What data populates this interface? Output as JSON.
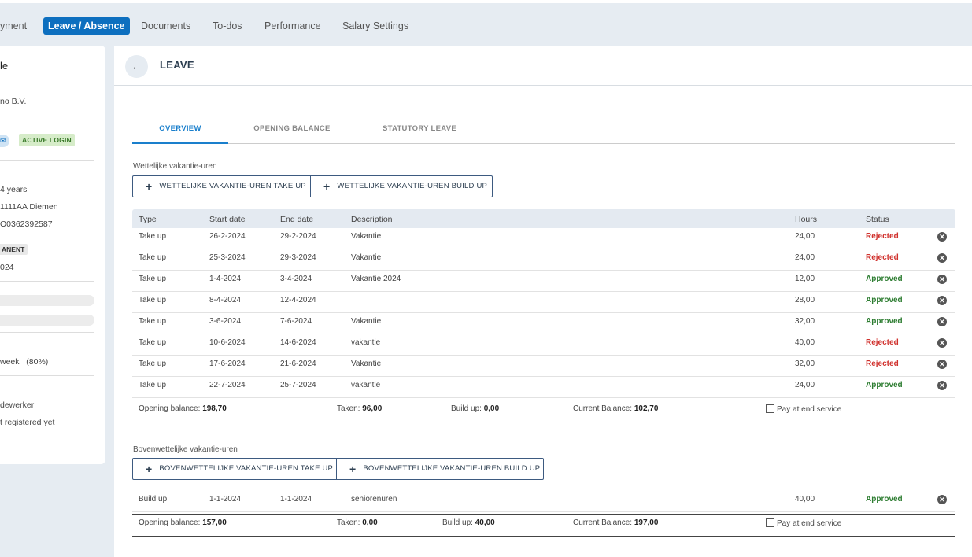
{
  "topnav": {
    "items": [
      {
        "label": "yment"
      },
      {
        "label": "Leave / Absence",
        "active": true
      },
      {
        "label": "Documents"
      },
      {
        "label": "To-dos"
      },
      {
        "label": "Performance"
      },
      {
        "label": "Salary Settings"
      }
    ]
  },
  "sidebar": {
    "title": "le",
    "company": "no B.V.",
    "login_badge": "ACTIVE LOGIN",
    "age": "4 years",
    "address": "1111AA Diemen",
    "iban": "O0362392587",
    "contract_badge": "ANENT",
    "contract_date": "024",
    "hours": "week",
    "hours_pct": "(80%)",
    "role": "dewerker",
    "not_registered": "t registered yet"
  },
  "header": {
    "title": "LEAVE",
    "back_icon": "arrow-left-icon"
  },
  "tabs": [
    {
      "label": "OVERVIEW",
      "active": true
    },
    {
      "label": "OPENING BALANCE"
    },
    {
      "label": "STATUTORY LEAVE"
    }
  ],
  "columns": [
    "Type",
    "Start date",
    "End date",
    "Description",
    "Hours",
    "Status"
  ],
  "statutory": {
    "label": "Wettelijke vakantie-uren",
    "take_up_button": "WETTELIJKE VAKANTIE-UREN TAKE UP",
    "build_up_button": "WETTELIJKE VAKANTIE-UREN BUILD UP",
    "rows": [
      {
        "type": "Take up",
        "start": "26-2-2024",
        "end": "29-2-2024",
        "description": "Vakantie",
        "hours": "24,00",
        "status": "Rejected"
      },
      {
        "type": "Take up",
        "start": "25-3-2024",
        "end": "29-3-2024",
        "description": "Vakantie",
        "hours": "24,00",
        "status": "Rejected"
      },
      {
        "type": "Take up",
        "start": "1-4-2024",
        "end": "3-4-2024",
        "description": "Vakantie 2024",
        "hours": "12,00",
        "status": "Approved"
      },
      {
        "type": "Take up",
        "start": "8-4-2024",
        "end": "12-4-2024",
        "description": "",
        "hours": "28,00",
        "status": "Approved"
      },
      {
        "type": "Take up",
        "start": "3-6-2024",
        "end": "7-6-2024",
        "description": "Vakantie",
        "hours": "32,00",
        "status": "Approved"
      },
      {
        "type": "Take up",
        "start": "10-6-2024",
        "end": "14-6-2024",
        "description": "vakantie",
        "hours": "40,00",
        "status": "Rejected"
      },
      {
        "type": "Take up",
        "start": "17-6-2024",
        "end": "21-6-2024",
        "description": "Vakantie",
        "hours": "32,00",
        "status": "Rejected"
      },
      {
        "type": "Take up",
        "start": "22-7-2024",
        "end": "25-7-2024",
        "description": "vakantie",
        "hours": "24,00",
        "status": "Approved"
      }
    ],
    "summary": {
      "opening_label": "Opening balance:",
      "opening": "198,70",
      "taken_label": "Taken:",
      "taken": "96,00",
      "buildup_label": "Build up:",
      "buildup": "0,00",
      "current_label": "Current Balance:",
      "current": "102,70",
      "pay_label": "Pay at end service"
    }
  },
  "extra": {
    "label": "Bovenwettelijke vakantie-uren",
    "take_up_button": "BOVENWETTELIJKE VAKANTIE-UREN TAKE UP",
    "build_up_button": "BOVENWETTELIJKE VAKANTIE-UREN BUILD UP",
    "rows": [
      {
        "type": "Build up",
        "start": "1-1-2024",
        "end": "1-1-2024",
        "description": "seniorenuren",
        "hours": "40,00",
        "status": "Approved"
      }
    ],
    "summary": {
      "opening_label": "Opening balance:",
      "opening": "157,00",
      "taken_label": "Taken:",
      "taken": "0,00",
      "buildup_label": "Build up:",
      "buildup": "40,00",
      "current_label": "Current Balance:",
      "current": "197,00",
      "pay_label": "Pay at end service"
    }
  },
  "colors": {
    "accent": "#0d6fbf",
    "rejected": "#d0312d",
    "approved": "#2e7d32",
    "panel_bg": "#e6ecf2"
  }
}
